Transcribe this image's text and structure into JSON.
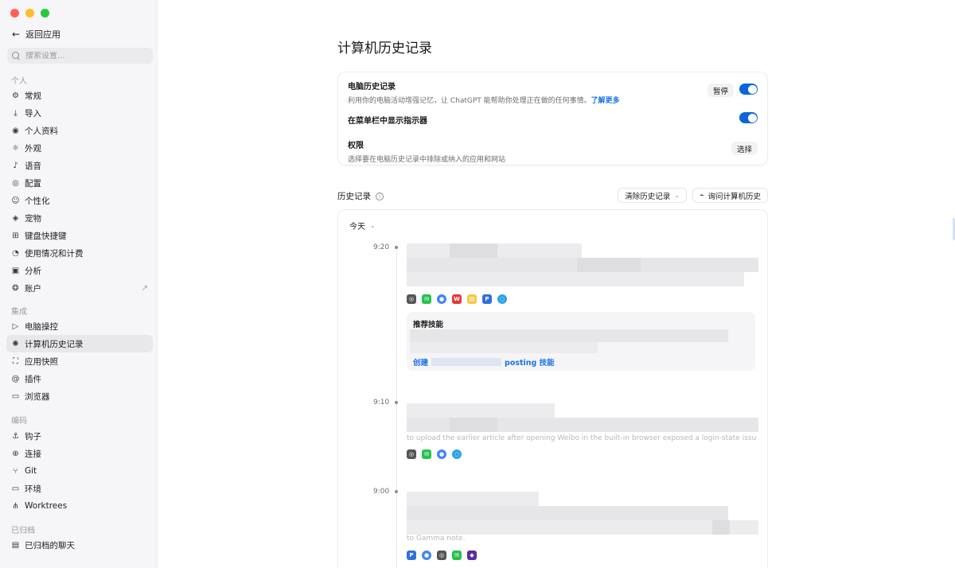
{
  "sidebar": {
    "back_label": "返回应用",
    "search_placeholder": "搜索设置...",
    "sections": [
      {
        "label": "个人",
        "items": [
          {
            "label": "常规",
            "icon": "gear-icon"
          },
          {
            "label": "导入",
            "icon": "import-icon"
          },
          {
            "label": "个人资料",
            "icon": "profile-icon"
          },
          {
            "label": "外观",
            "icon": "sun-icon"
          },
          {
            "label": "语音",
            "icon": "mic-icon"
          },
          {
            "label": "配置",
            "icon": "config-icon"
          },
          {
            "label": "个性化",
            "icon": "personalize-icon"
          },
          {
            "label": "宠物",
            "icon": "pet-icon"
          },
          {
            "label": "键盘快捷键",
            "icon": "keyboard-icon"
          },
          {
            "label": "使用情况和计费",
            "icon": "gauge-icon"
          },
          {
            "label": "分析",
            "icon": "analytics-icon"
          },
          {
            "label": "账户",
            "icon": "account-icon"
          }
        ]
      },
      {
        "label": "集成",
        "items": [
          {
            "label": "电脑操控",
            "icon": "cursor-icon"
          },
          {
            "label": "计算机历史记录",
            "icon": "history-icon"
          },
          {
            "label": "应用快照",
            "icon": "snapshot-icon"
          },
          {
            "label": "插件",
            "icon": "plugin-icon"
          },
          {
            "label": "浏览器",
            "icon": "browser-icon"
          }
        ]
      },
      {
        "label": "编码",
        "items": [
          {
            "label": "钩子",
            "icon": "hook-icon"
          },
          {
            "label": "连接",
            "icon": "globe-icon"
          },
          {
            "label": "Git",
            "icon": "git-branch-icon"
          },
          {
            "label": "环境",
            "icon": "monitor-icon"
          },
          {
            "label": "Worktrees",
            "icon": "worktree-icon"
          }
        ]
      },
      {
        "label": "已归档",
        "items": [
          {
            "label": "已归档的聊天",
            "icon": "archive-icon"
          }
        ]
      }
    ]
  },
  "page": {
    "title": "计算机历史记录"
  },
  "settings": {
    "history": {
      "title": "电脑历史记录",
      "desc": "利用你的电脑活动增强记忆，让 ChatGPT 能帮助你处理正在做的任何事情。",
      "learn_more": "了解更多",
      "pause_label": "暂停",
      "enabled": true
    },
    "menubar": {
      "title": "在菜单栏中显示指示器",
      "enabled": true
    },
    "permissions": {
      "title": "权限",
      "desc": "选择要在电脑历史记录中排除或纳入的应用和网站",
      "choose_label": "选择"
    }
  },
  "history": {
    "label": "历史记录",
    "clear_label": "清除历史记录",
    "ask_label": "询问计算机历史",
    "day_label": "今天",
    "entries": [
      {
        "time": "9:20"
      },
      {
        "time": "9:10",
        "partial_text": "to upload the earlier article after opening Weibo in the built-in browser exposed a login-state issue."
      },
      {
        "time": "9:00",
        "partial_text": "to Gamma note."
      }
    ],
    "skill": {
      "title": "推荐技能",
      "create_prefix": "创建",
      "create_suffix": "posting 技能"
    }
  },
  "colors": {
    "accent": "#0b66d6",
    "link": "#1a73e8"
  }
}
